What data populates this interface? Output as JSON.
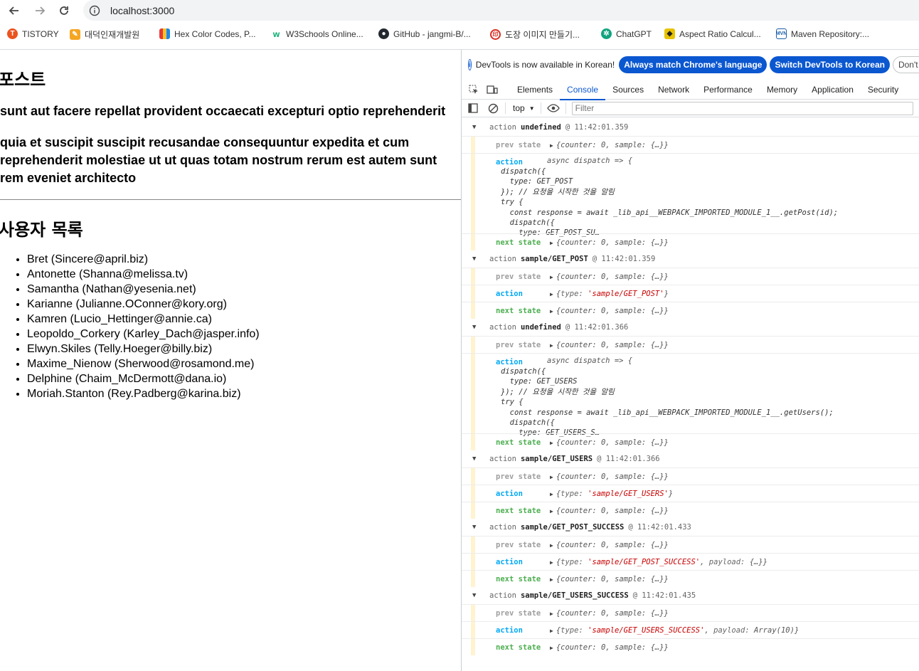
{
  "browser": {
    "url": "localhost:3000",
    "bookmarks": [
      {
        "label": "TISTORY",
        "icon": "tistory-icon",
        "color": "#eb531f"
      },
      {
        "label": "대덕인재개발원",
        "icon": "daedeok-icon",
        "color": "#f5a623"
      },
      {
        "label": "Hex Color Codes, P...",
        "icon": "hex-color-icon",
        "color": "#3d6fd8"
      },
      {
        "label": "W3Schools Online...",
        "icon": "w3schools-icon",
        "color": "#04aa6d"
      },
      {
        "label": "GitHub - jangmi-B/...",
        "icon": "github-icon",
        "color": "#24292f"
      },
      {
        "label": "도장 이미지 만들기...",
        "icon": "stamp-icon",
        "color": "#d93025"
      },
      {
        "label": "ChatGPT",
        "icon": "chatgpt-icon",
        "color": "#10a37f"
      },
      {
        "label": "Aspect Ratio Calcul...",
        "icon": "aspect-ratio-icon",
        "color": "#e8c300"
      },
      {
        "label": "Maven Repository:...",
        "icon": "maven-icon",
        "color": "#1a5ea8"
      }
    ]
  },
  "page": {
    "post_heading": "포스트",
    "post_title": "sunt aut facere repellat provident occaecati excepturi optio reprehenderit",
    "post_body": "quia et suscipit suscipit recusandae consequuntur expedita et cum reprehenderit molestiae ut ut quas totam nostrum rerum est autem sunt rem eveniet architecto",
    "users_heading": "사용자 목록",
    "users": [
      "Bret (Sincere@april.biz)",
      "Antonette (Shanna@melissa.tv)",
      "Samantha (Nathan@yesenia.net)",
      "Karianne (Julianne.OConner@kory.org)",
      "Kamren (Lucio_Hettinger@annie.ca)",
      "Leopoldo_Corkery (Karley_Dach@jasper.info)",
      "Elwyn.Skiles (Telly.Hoeger@billy.biz)",
      "Maxime_Nienow (Sherwood@rosamond.me)",
      "Delphine (Chaim_McDermott@dana.io)",
      "Moriah.Stanton (Rey.Padberg@karina.biz)"
    ]
  },
  "devtools": {
    "info_text": "DevTools is now available in Korean!",
    "btn_match": "Always match Chrome's language",
    "btn_switch": "Switch DevTools to Korean",
    "btn_dont": "Don't show",
    "tabs": [
      "Elements",
      "Console",
      "Sources",
      "Network",
      "Performance",
      "Memory",
      "Application",
      "Security"
    ],
    "active_tab": "Console",
    "context": "top",
    "filter_placeholder": "Filter",
    "labels": {
      "action": "action",
      "prev": "prev state",
      "next": "next state",
      "state_obj": "{counter: 0, sample: {…}}"
    },
    "log": {
      "g1": {
        "name": "undefined",
        "time": "@ 11:42:01.359",
        "fn": "async dispatch => {",
        "code": "dispatch({\n  type: GET_POST\n}); // 요청을 시작한 것을 알림\ntry {\n  const response = await _lib_api__WEBPACK_IMPORTED_MODULE_1__.getPost(id);\n  dispatch({\n    type: GET_POST_SU…"
      },
      "g2": {
        "name": "sample/GET_POST",
        "time": "@ 11:42:01.359",
        "type": "'sample/GET_POST'"
      },
      "g3": {
        "name": "undefined",
        "time": "@ 11:42:01.366",
        "fn": "async dispatch => {",
        "code": "dispatch({\n  type: GET_USERS\n}); // 요청을 시작한 것을 알림\ntry {\n  const response = await _lib_api__WEBPACK_IMPORTED_MODULE_1__.getUsers();\n  dispatch({\n    type: GET_USERS_S…"
      },
      "g4": {
        "name": "sample/GET_USERS",
        "time": "@ 11:42:01.366",
        "type": "'sample/GET_USERS'"
      },
      "g5": {
        "name": "sample/GET_POST_SUCCESS",
        "time": "@ 11:42:01.433",
        "type": "'sample/GET_POST_SUCCESS'",
        "payload": "{…}"
      },
      "g6": {
        "name": "sample/GET_USERS_SUCCESS",
        "time": "@ 11:42:01.435",
        "type": "'sample/GET_USERS_SUCCESS'",
        "payload": "Array(10)"
      }
    }
  }
}
